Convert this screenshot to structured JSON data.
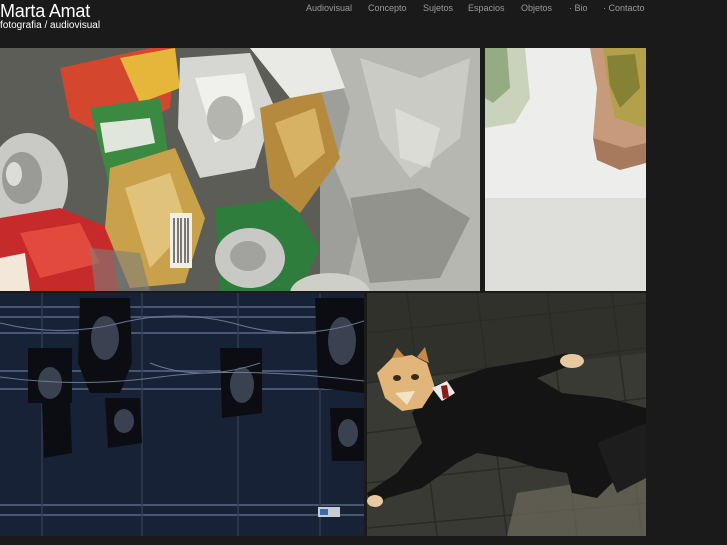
{
  "brand": {
    "name": "Marta Amat",
    "tagline": "fotografia / audiovisual"
  },
  "nav": {
    "items": [
      {
        "label": "Audiovisual"
      },
      {
        "label": "Concepto"
      },
      {
        "label": "Sujetos"
      },
      {
        "label": "Espacios"
      },
      {
        "label": "Objetos"
      },
      {
        "label": "· Bio"
      },
      {
        "label": "· Contacto"
      }
    ]
  },
  "gallery": {
    "images": [
      {
        "subject": "crushed cans and foil"
      },
      {
        "subject": "hand with tattoo on pale background"
      },
      {
        "subject": "stage lights on rig"
      },
      {
        "subject": "person in suit with fox mask lying on pavement"
      }
    ]
  },
  "colors": {
    "page_background": "#1a1a1a",
    "brand_text": "#ffffff",
    "nav_text": "#9a9a9a"
  }
}
